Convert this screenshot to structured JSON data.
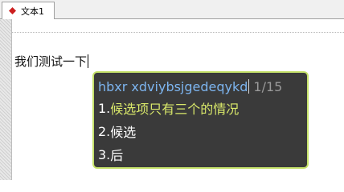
{
  "tab": {
    "label": "文本1",
    "icon": "document-diamond-icon"
  },
  "editor": {
    "text": "我们测试一下"
  },
  "ime": {
    "composition": "hbxr xdviybsjgedeqykd",
    "page_indicator": "1/15",
    "candidates": [
      {
        "index": "1.",
        "text": "候选项只有三个的情况",
        "selected": true
      },
      {
        "index": "2.",
        "text": "候选",
        "selected": false
      },
      {
        "index": "3.",
        "text": "后",
        "selected": false
      }
    ]
  },
  "colors": {
    "popup_background": "#3a3a3a",
    "popup_border": "#c6e26a",
    "composition_text": "#7db5f0",
    "selected_candidate": "#d9e86a",
    "tab_icon": "#cc1f1f"
  }
}
